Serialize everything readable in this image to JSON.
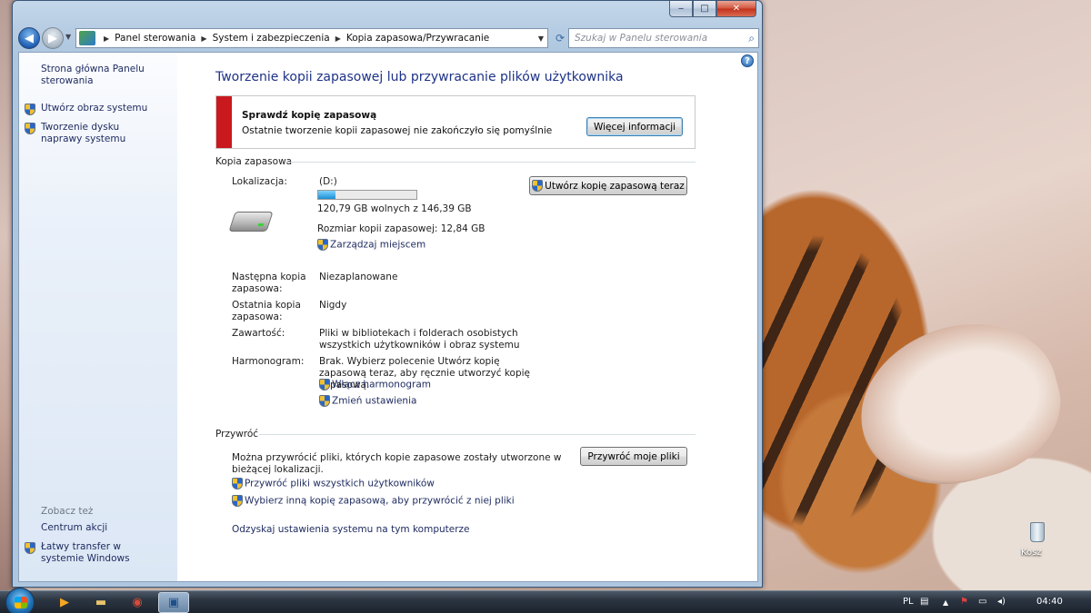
{
  "window": {
    "minimize_glyph": "‒",
    "maximize_glyph": "□",
    "close_glyph": "✕"
  },
  "navigation": {
    "back_glyph": "◀",
    "forward_glyph": "▶",
    "breadcrumb": [
      "Panel sterowania",
      "System i zabezpieczenia",
      "Kopia zapasowa/Przywracanie"
    ],
    "search_placeholder": "Szukaj w Panelu sterowania"
  },
  "sidebar": {
    "items": [
      {
        "label": "Strona główna Panelu sterowania",
        "shield": false
      },
      {
        "label": "Utwórz obraz systemu",
        "shield": true
      },
      {
        "label": "Tworzenie dysku naprawy systemu",
        "shield": true
      }
    ],
    "see_also_heading": "Zobacz też",
    "see_also": [
      {
        "label": "Centrum akcji",
        "shield": false
      },
      {
        "label": "Łatwy transfer w systemie Windows",
        "shield": true
      }
    ]
  },
  "main": {
    "title": "Tworzenie kopii zapasowej lub przywracanie plików użytkownika",
    "alert": {
      "heading": "Sprawdź kopię zapasową",
      "text": "Ostatnie tworzenie kopii zapasowej nie zakończyło się pomyślnie",
      "button": "Więcej informacji",
      "color": "#c9191e"
    },
    "backup": {
      "section_title": "Kopia zapasowa",
      "location_label": "Lokalizacja:",
      "drive": "(D:)",
      "free_space": "120,79 GB wolnych z 146,39 GB",
      "used_fraction": 0.175,
      "backup_size": "Rozmiar kopii zapasowej: 12,84 GB",
      "manage_link": "Zarządzaj miejscem",
      "backup_now_button": "Utwórz kopię zapasową teraz",
      "rows": [
        {
          "label": "Następna kopia zapasowa:",
          "value": "Niezaplanowane"
        },
        {
          "label": "Ostatnia kopia zapasowa:",
          "value": "Nigdy"
        },
        {
          "label": "Zawartość:",
          "value": "Pliki w bibliotekach i folderach osobistych wszystkich użytkowników i obraz systemu"
        },
        {
          "label": "Harmonogram:",
          "value": "Brak. Wybierz polecenie Utwórz kopię zapasową teraz, aby ręcznie utworzyć kopię zapasową."
        }
      ],
      "schedule_link": "Włącz harmonogram",
      "settings_link": "Zmień ustawienia"
    },
    "restore": {
      "section_title": "Przywróć",
      "text": "Można przywrócić pliki, których kopie zapasowe zostały utworzone w bieżącej lokalizacji.",
      "button": "Przywróć moje pliki",
      "links": [
        "Przywróć pliki wszystkich użytkowników",
        "Wybierz inną kopię zapasową, aby przywrócić z niej pliki"
      ],
      "recover_link": "Odzyskaj ustawienia systemu na tym komputerze"
    }
  },
  "desktop": {
    "recycle_bin_label": "Kosz"
  },
  "taskbar": {
    "language": "PL",
    "clock": "04:40",
    "apps": [
      "media-player-icon",
      "explorer-icon",
      "chrome-icon",
      "control-panel-icon"
    ]
  }
}
